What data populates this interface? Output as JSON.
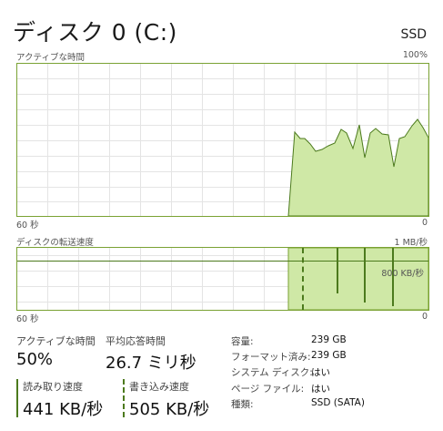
{
  "header": {
    "title": "ディスク 0 (C:)",
    "disk_type": "SSD"
  },
  "active_time_graph": {
    "label": "アクティブな時間",
    "max_label": "100%",
    "time_left": "60 秒",
    "time_right": "0"
  },
  "transfer_graph": {
    "label": "ディスクの転送速度",
    "max_label": "1 MB/秒",
    "ref_line_label": "800 KB/秒",
    "time_left": "60 秒",
    "time_right": "0"
  },
  "stats": {
    "active_time": {
      "label": "アクティブな時間",
      "value": "50%"
    },
    "avg_response": {
      "label": "平均応答時間",
      "value": "26.7 ミリ秒"
    },
    "read_speed": {
      "label": "読み取り速度",
      "value": "441 KB/秒"
    },
    "write_speed": {
      "label": "書き込み速度",
      "value": "505 KB/秒"
    }
  },
  "details": [
    {
      "label": "容量:",
      "value": "239 GB"
    },
    {
      "label": "フォーマット済み:",
      "value": "239 GB"
    },
    {
      "label": "システム ディスク:",
      "value": "はい"
    },
    {
      "label": "ページ ファイル:",
      "value": "はい"
    },
    {
      "label": "種類:",
      "value": "SSD (SATA)"
    }
  ],
  "colors": {
    "accent_line": "#4c7a1d",
    "fill": "#cfe8a6",
    "grid": "#e4e4e4",
    "border": "#7aa233"
  }
}
